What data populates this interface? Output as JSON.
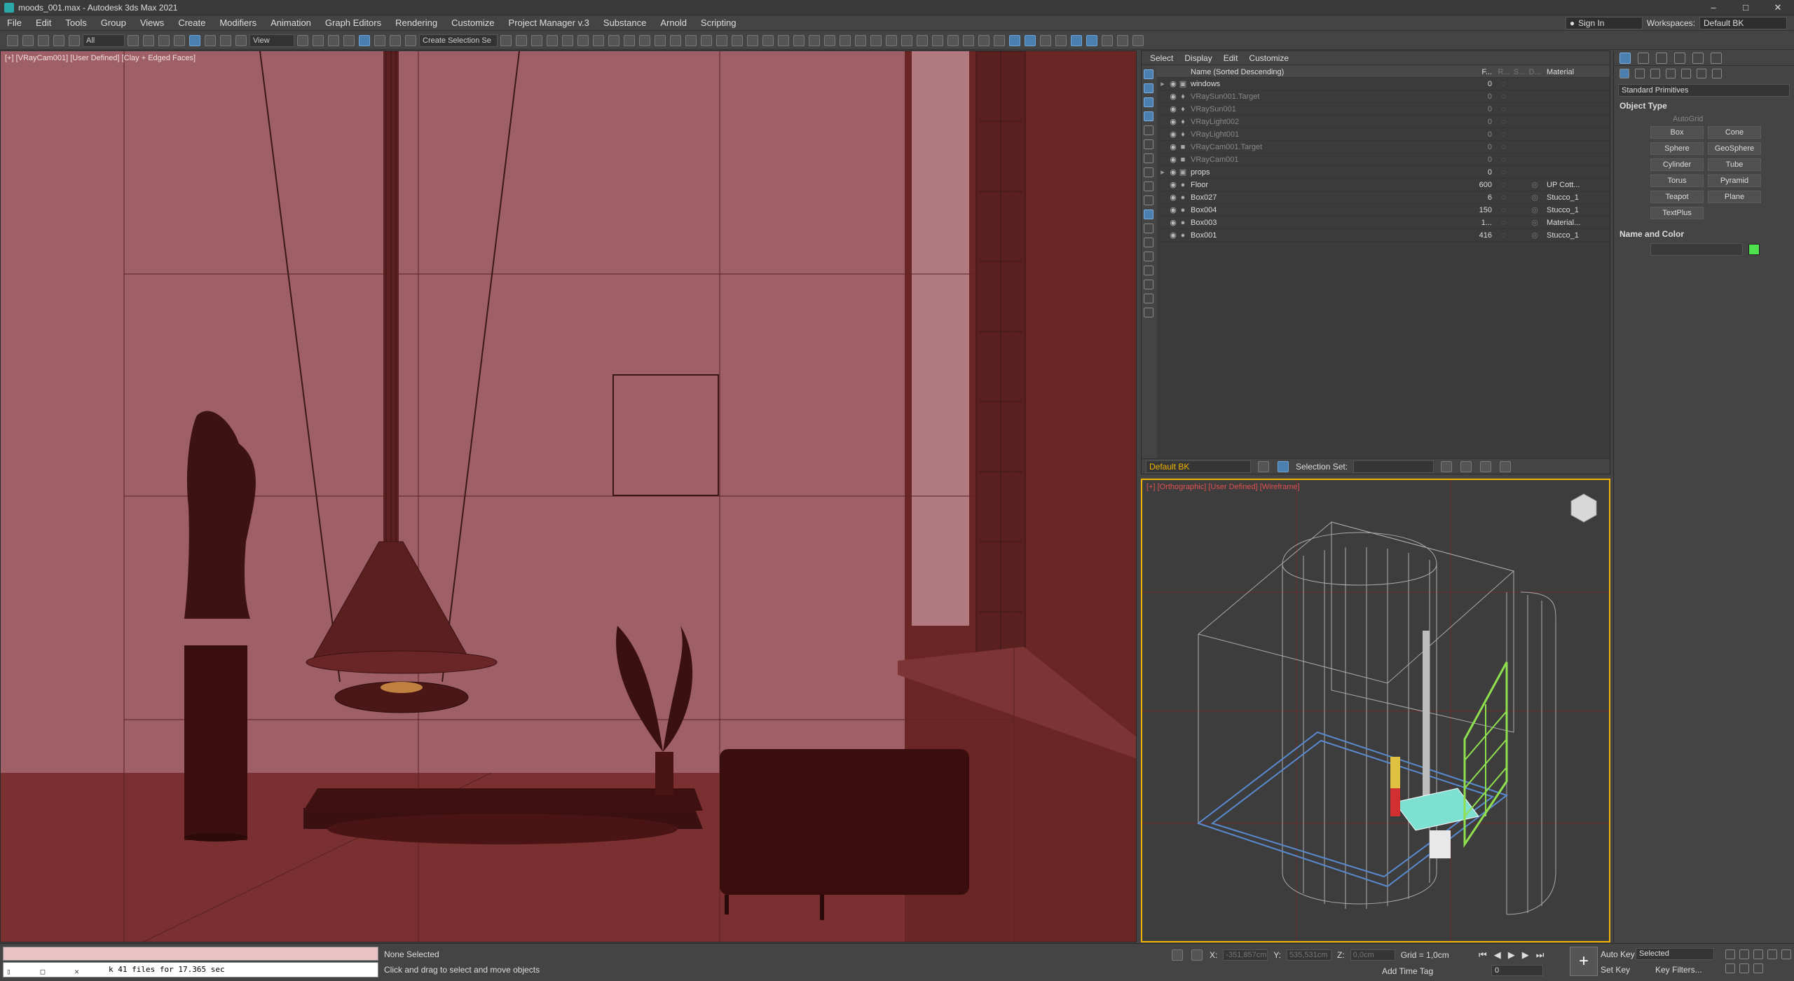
{
  "window": {
    "title": "moods_001.max - Autodesk 3ds Max 2021",
    "min": "–",
    "max": "□",
    "close": "✕"
  },
  "menu": {
    "items": [
      "File",
      "Edit",
      "Tools",
      "Group",
      "Views",
      "Create",
      "Modifiers",
      "Animation",
      "Graph Editors",
      "Rendering",
      "Customize",
      "Project Manager v.3",
      "Substance",
      "Arnold",
      "Scripting"
    ],
    "sign_in": "Sign In",
    "workspaces_label": "Workspaces:",
    "workspace_value": "Default BK"
  },
  "toolbar": {
    "filter": "All",
    "ref_coord": "View",
    "selection_set": "Create Selection Se"
  },
  "viewport_main": {
    "label": "[+] [VRayCam001] [User Defined] [Clay + Edged Faces]"
  },
  "explorer": {
    "tabs": [
      "Select",
      "Display",
      "Edit",
      "Customize"
    ],
    "headers": {
      "name": "Name (Sorted Descending)",
      "faces": "F...",
      "r": "R...",
      "s": "S...",
      "d": "D...",
      "material": "Material"
    },
    "rows": [
      {
        "name": "windows",
        "faces": "0",
        "material": "",
        "dim": false,
        "group": true
      },
      {
        "name": "VRaySun001.Target",
        "faces": "0",
        "material": "",
        "dim": true,
        "group": false
      },
      {
        "name": "VRaySun001",
        "faces": "0",
        "material": "",
        "dim": true,
        "group": false
      },
      {
        "name": "VRayLight002",
        "faces": "0",
        "material": "",
        "dim": true,
        "group": false
      },
      {
        "name": "VRayLight001",
        "faces": "0",
        "material": "",
        "dim": true,
        "group": false
      },
      {
        "name": "VRayCam001.Target",
        "faces": "0",
        "material": "",
        "dim": true,
        "group": false
      },
      {
        "name": "VRayCam001",
        "faces": "0",
        "material": "",
        "dim": true,
        "group": false
      },
      {
        "name": "props",
        "faces": "0",
        "material": "",
        "dim": false,
        "group": true
      },
      {
        "name": "Floor",
        "faces": "600",
        "material": "UP Cott...",
        "dim": false,
        "group": false
      },
      {
        "name": "Box027",
        "faces": "6",
        "material": "Stucco_1",
        "dim": false,
        "group": false
      },
      {
        "name": "Box004",
        "faces": "150",
        "material": "Stucco_1",
        "dim": false,
        "group": false
      },
      {
        "name": "Box003",
        "faces": "1...",
        "material": "Material...",
        "dim": false,
        "group": false
      },
      {
        "name": "Box001",
        "faces": "416",
        "material": "Stucco_1",
        "dim": false,
        "group": false
      }
    ],
    "layer": "Default BK",
    "selection_set_label": "Selection Set:"
  },
  "viewport_persp": {
    "label": "[+] [Orthographic] [User Defined] [Wireframe]"
  },
  "command_panel": {
    "category": "Standard Primitives",
    "object_type_title": "Object Type",
    "autogrid": "AutoGrid",
    "buttons": [
      "Box",
      "Cone",
      "Sphere",
      "GeoSphere",
      "Cylinder",
      "Tube",
      "Torus",
      "Pyramid",
      "Teapot",
      "Plane",
      "TextPlus"
    ],
    "name_color_title": "Name and Color",
    "color": "#4ee04e"
  },
  "status": {
    "script_output": "k 41 files for 17.365 sec",
    "selection": "None Selected",
    "hint": "Click and drag to select and move objects",
    "x_label": "X:",
    "x_value": "-351,857cm",
    "y_label": "Y:",
    "y_value": "535,531cm",
    "z_label": "Z:",
    "z_value": "0,0cm",
    "grid": "Grid = 1,0cm",
    "add_time_tag": "Add Time Tag",
    "frame": "0",
    "auto_key": "Auto Key",
    "set_key": "Set Key",
    "key_mode": "Selected",
    "key_filters": "Key Filters..."
  }
}
